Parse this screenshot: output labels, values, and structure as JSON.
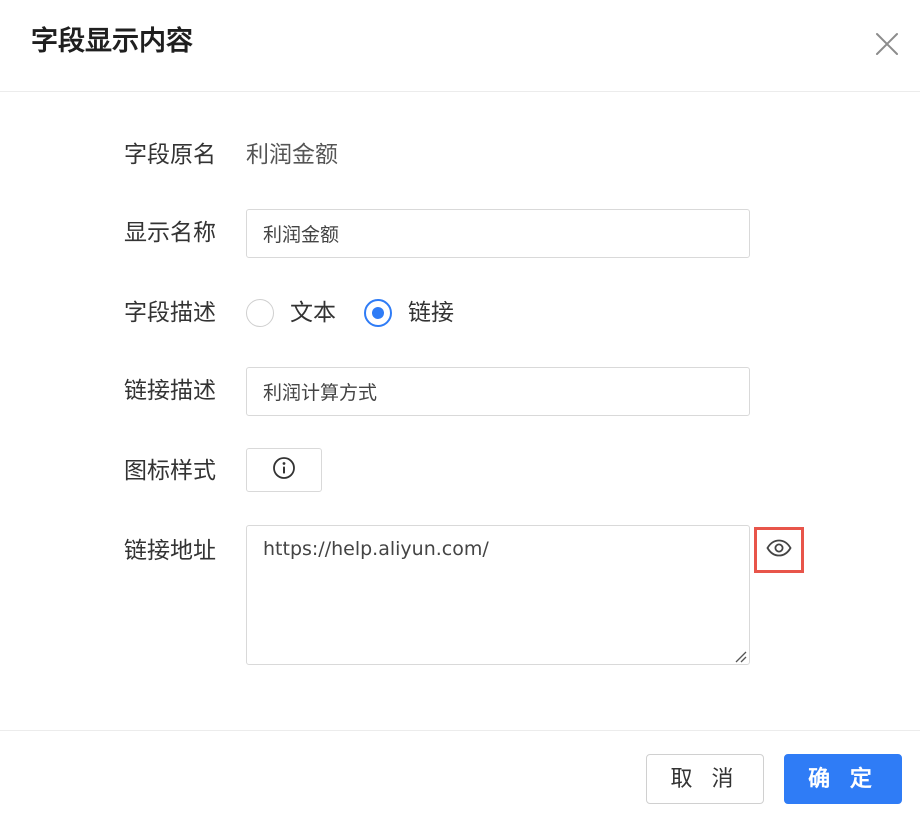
{
  "dialog": {
    "title": "字段显示内容",
    "close_icon": "close-icon"
  },
  "form": {
    "original_name": {
      "label": "字段原名",
      "value": "利润金额"
    },
    "display_name": {
      "label": "显示名称",
      "value": "利润金额"
    },
    "field_description": {
      "label": "字段描述",
      "options": [
        {
          "label": "文本",
          "checked": false
        },
        {
          "label": "链接",
          "checked": true
        }
      ]
    },
    "link_description": {
      "label": "链接描述",
      "value": "利润计算方式"
    },
    "icon_style": {
      "label": "图标样式",
      "icon": "info-circle-icon"
    },
    "link_address": {
      "label": "链接地址",
      "value": "https://help.aliyun.com/",
      "preview_icon": "eye-icon"
    }
  },
  "footer": {
    "cancel_label": "取 消",
    "ok_label": "确 定"
  },
  "colors": {
    "primary": "#2f7cf6",
    "highlight_border": "#e8554a"
  }
}
